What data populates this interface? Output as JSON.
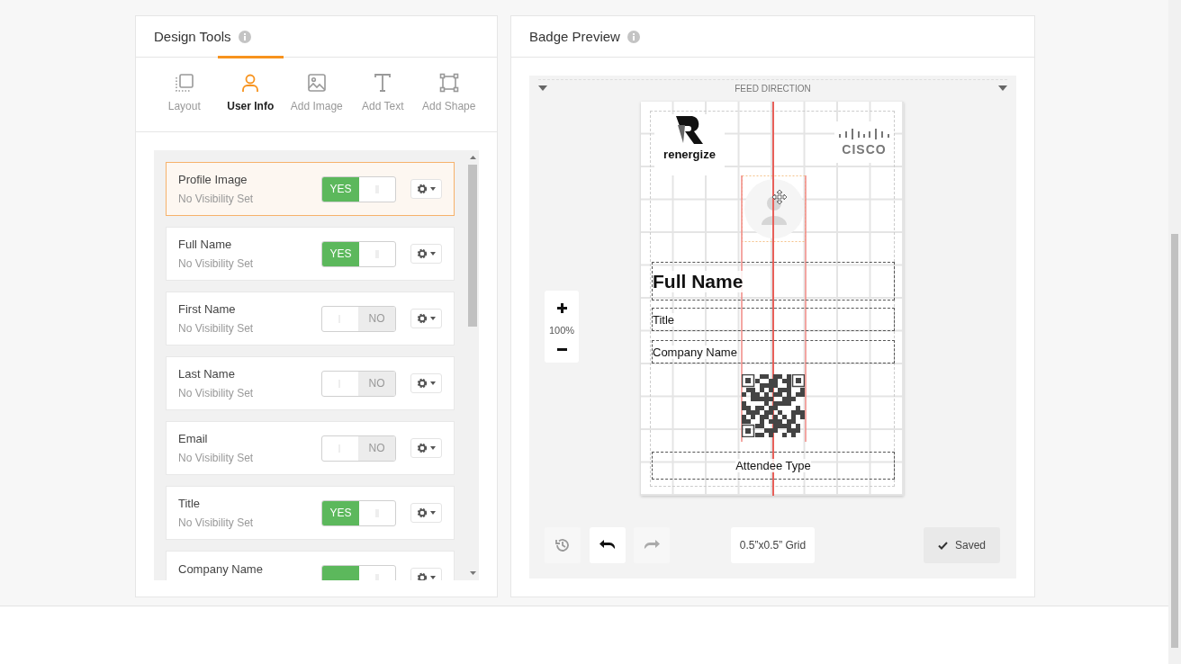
{
  "design_tools": {
    "title": "Design Tools",
    "tabs": [
      {
        "label": "Layout",
        "selected": false
      },
      {
        "label": "User Info",
        "selected": true
      },
      {
        "label": "Add Image",
        "selected": false
      },
      {
        "label": "Add Text",
        "selected": false
      },
      {
        "label": "Add Shape",
        "selected": false
      }
    ],
    "fields": [
      {
        "name": "Profile Image",
        "visibility": "No Visibility Set",
        "on": true,
        "toggle_label": "YES",
        "selected": true
      },
      {
        "name": "Full Name",
        "visibility": "No Visibility Set",
        "on": true,
        "toggle_label": "YES",
        "selected": false
      },
      {
        "name": "First Name",
        "visibility": "No Visibility Set",
        "on": false,
        "toggle_label": "NO",
        "selected": false
      },
      {
        "name": "Last Name",
        "visibility": "No Visibility Set",
        "on": false,
        "toggle_label": "NO",
        "selected": false
      },
      {
        "name": "Email",
        "visibility": "No Visibility Set",
        "on": false,
        "toggle_label": "NO",
        "selected": false
      },
      {
        "name": "Title",
        "visibility": "No Visibility Set",
        "on": true,
        "toggle_label": "YES",
        "selected": false
      },
      {
        "name": "Company Name",
        "on": true,
        "selected": false
      }
    ]
  },
  "badge_preview": {
    "title": "Badge Preview",
    "feed_direction": "FEED DIRECTION",
    "logo_left": "renergize",
    "logo_right": "CISCO",
    "text_elements": [
      {
        "kind": "name",
        "text": "Full Name"
      },
      {
        "kind": "line",
        "text": "Title"
      },
      {
        "kind": "line",
        "text": "Company Name"
      },
      {
        "kind": "type",
        "text": "Attendee Type"
      }
    ],
    "zoom": "100%",
    "grid_button": "0.5”x0.5” Grid",
    "save_status": "Saved"
  }
}
